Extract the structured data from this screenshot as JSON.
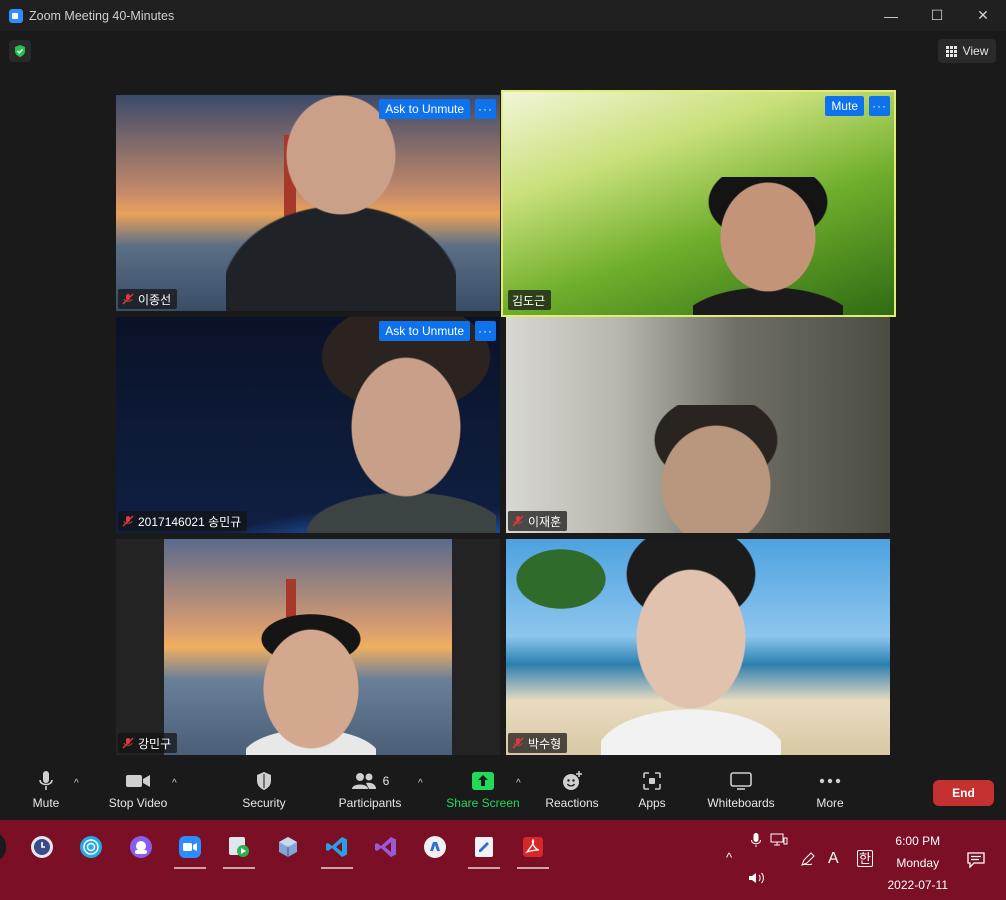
{
  "window": {
    "title": "Zoom Meeting 40-Minutes",
    "minimize": "—",
    "maximize": "☐",
    "close": "✕"
  },
  "view_button": {
    "label": "View"
  },
  "tiles": [
    {
      "name": "이종선",
      "actions": [
        "Ask to Unmute",
        "···"
      ]
    },
    {
      "name": "김도근",
      "actions": [
        "Mute",
        "···"
      ]
    },
    {
      "name": "2017146021 송민규",
      "actions": [
        "Ask to Unmute",
        "···"
      ]
    },
    {
      "name": "이재훈",
      "actions": []
    },
    {
      "name": "강민구",
      "actions": []
    },
    {
      "name": "박수형",
      "actions": []
    }
  ],
  "toolbar": {
    "mute": "Mute",
    "stop_video": "Stop Video",
    "security": "Security",
    "participants": "Participants",
    "participants_count": "6",
    "share_screen": "Share Screen",
    "reactions": "Reactions",
    "apps": "Apps",
    "whiteboards": "Whiteboards",
    "more": "More",
    "end": "End",
    "caret": "^"
  },
  "taskbar": {
    "time": "6:00 PM",
    "day": "Monday",
    "date": "2022-07-11",
    "ime_a": "A",
    "ime_han": "한",
    "tray_caret": "^"
  },
  "colors": {
    "accent_blue": "#0e72ed",
    "share_green": "#23d959",
    "end_red": "#c53030",
    "active_outline": "#e4ec73",
    "taskbar": "#7a0f26"
  }
}
